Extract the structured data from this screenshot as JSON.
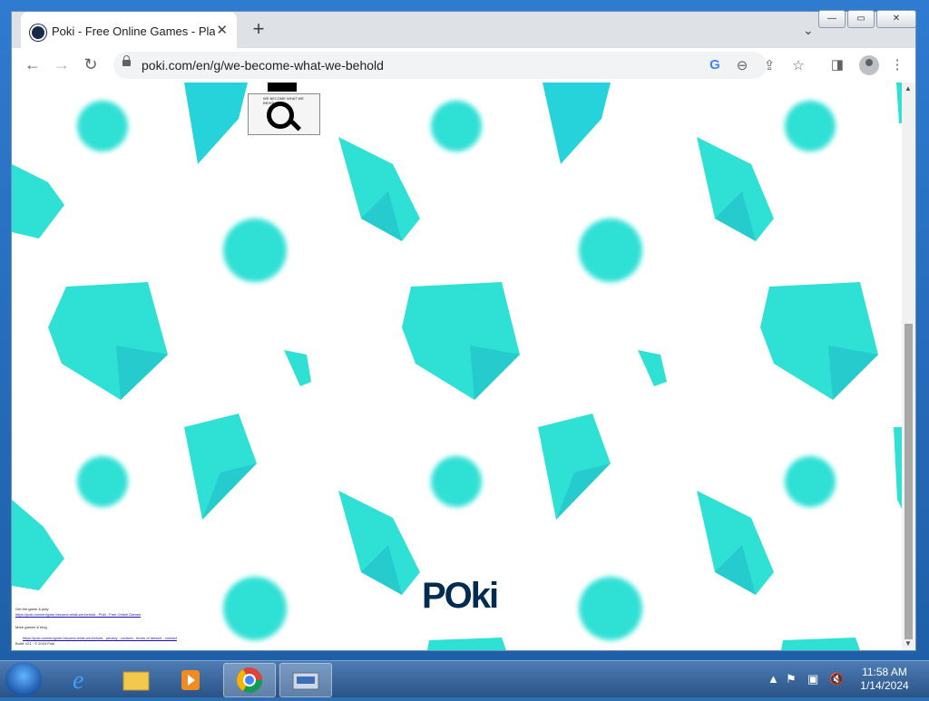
{
  "browser": {
    "tab_title": "Poki - Free Online Games - Play F",
    "tab_close": "✕",
    "new_tab": "+",
    "url": "poki.com/en/g/we-become-what-we-behold",
    "window_buttons": [
      "—",
      "▭",
      "✕"
    ]
  },
  "page": {
    "logo": "POki",
    "search_caption": "WE BECOME WHAT WE BEHOLD",
    "footer_lines": [
      "Get the game & play",
      "https://poki.com/en/g/we-become-what-we-behold · Poki - Free Online Games",
      "More games & blog",
      "https://poki.com/en/g/we-become-what-we-behold · privacy · cookies · terms of service · contact",
      "Build: v21 · © 2024 Poki"
    ]
  },
  "taskbar": {
    "time": "11:58 AM",
    "date": "1/14/2024",
    "apps": [
      "internet-explorer",
      "file-explorer",
      "media-player",
      "chrome",
      "keyboard"
    ]
  },
  "colors": {
    "gem": "#2fe0d5",
    "gem_dark": "#1fbcc8",
    "logo": "#002b50",
    "page_bg": "#ffffff"
  }
}
